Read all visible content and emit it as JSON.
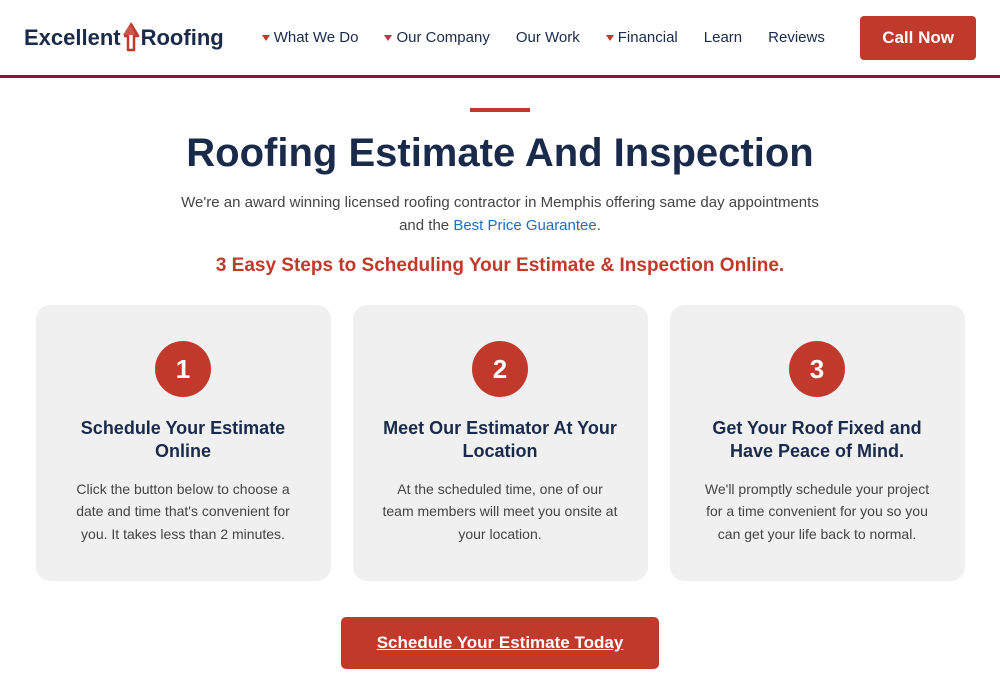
{
  "brand": {
    "name_part1": "Excellent",
    "name_part2": "Roofing",
    "logo_alt": "Excellent Roofing Logo"
  },
  "nav": {
    "items": [
      {
        "label": "What We Do",
        "has_arrow": true
      },
      {
        "label": "Our Company",
        "has_arrow": true
      },
      {
        "label": "Our Work",
        "has_arrow": false
      },
      {
        "label": "Financial",
        "has_arrow": true
      },
      {
        "label": "Learn",
        "has_arrow": false
      },
      {
        "label": "Reviews",
        "has_arrow": false
      }
    ],
    "cta_label": "Call Now"
  },
  "hero": {
    "title": "Roofing Estimate And Inspection",
    "subtitle_text": "We're an award winning licensed roofing contractor in Memphis offering same day appointments and the ",
    "subtitle_link_text": "Best Price Guarantee",
    "subtitle_end": ".",
    "steps_heading": "3 Easy Steps to Scheduling Your Estimate & Inspection Online."
  },
  "cards": [
    {
      "step": "1",
      "title": "Schedule Your Estimate Online",
      "description": "Click the button below to choose a date and time that's convenient for you. It takes less than 2 minutes."
    },
    {
      "step": "2",
      "title": "Meet Our Estimator At Your Location",
      "description": "At the scheduled time, one of our team members will meet you onsite at your location."
    },
    {
      "step": "3",
      "title": "Get Your Roof Fixed and Have Peace of Mind.",
      "description": "We'll promptly schedule your project for a time convenient for you so you can get your life back to normal."
    }
  ],
  "cta": {
    "label": "Schedule Your Estimate Today"
  }
}
